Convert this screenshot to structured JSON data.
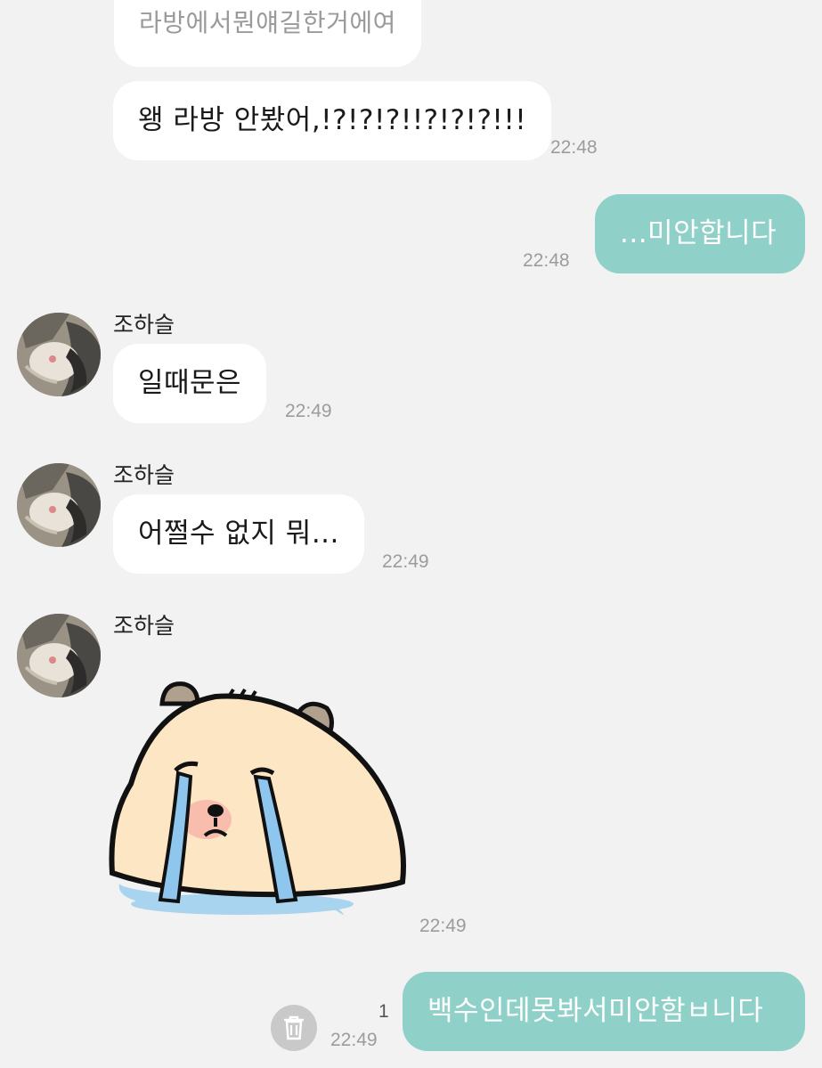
{
  "colors": {
    "background": "#f2f2f2",
    "incoming_bubble": "#ffffff",
    "outgoing_bubble": "#8fd1c8",
    "outgoing_text": "#ffffff",
    "timestamp": "#9c9c9c"
  },
  "messages": [
    {
      "id": "m0",
      "direction": "incoming",
      "text": "라방에서뭔얘길한거에여",
      "time": ""
    },
    {
      "id": "m1",
      "direction": "incoming",
      "text": "왱 라방 안봤어,!?!?!?!!?!?!?!!!",
      "time": "22:48"
    },
    {
      "id": "m2",
      "direction": "outgoing",
      "text": "...미안합니다",
      "time": "22:48"
    },
    {
      "id": "m3",
      "direction": "incoming",
      "sender": "조하슬",
      "text": "일때문은",
      "time": "22:49"
    },
    {
      "id": "m4",
      "direction": "incoming",
      "sender": "조하슬",
      "text": "어쩔수 없지 뭐...",
      "time": "22:49"
    },
    {
      "id": "m5",
      "direction": "incoming",
      "sender": "조하슬",
      "sticker": "crying-bear-sticker",
      "time": "22:49"
    },
    {
      "id": "m6",
      "direction": "outgoing",
      "text": "백수인데못봐서미안함ㅂ니다",
      "time": "22:49",
      "unread": "1",
      "action_icon": "trash-icon"
    }
  ]
}
